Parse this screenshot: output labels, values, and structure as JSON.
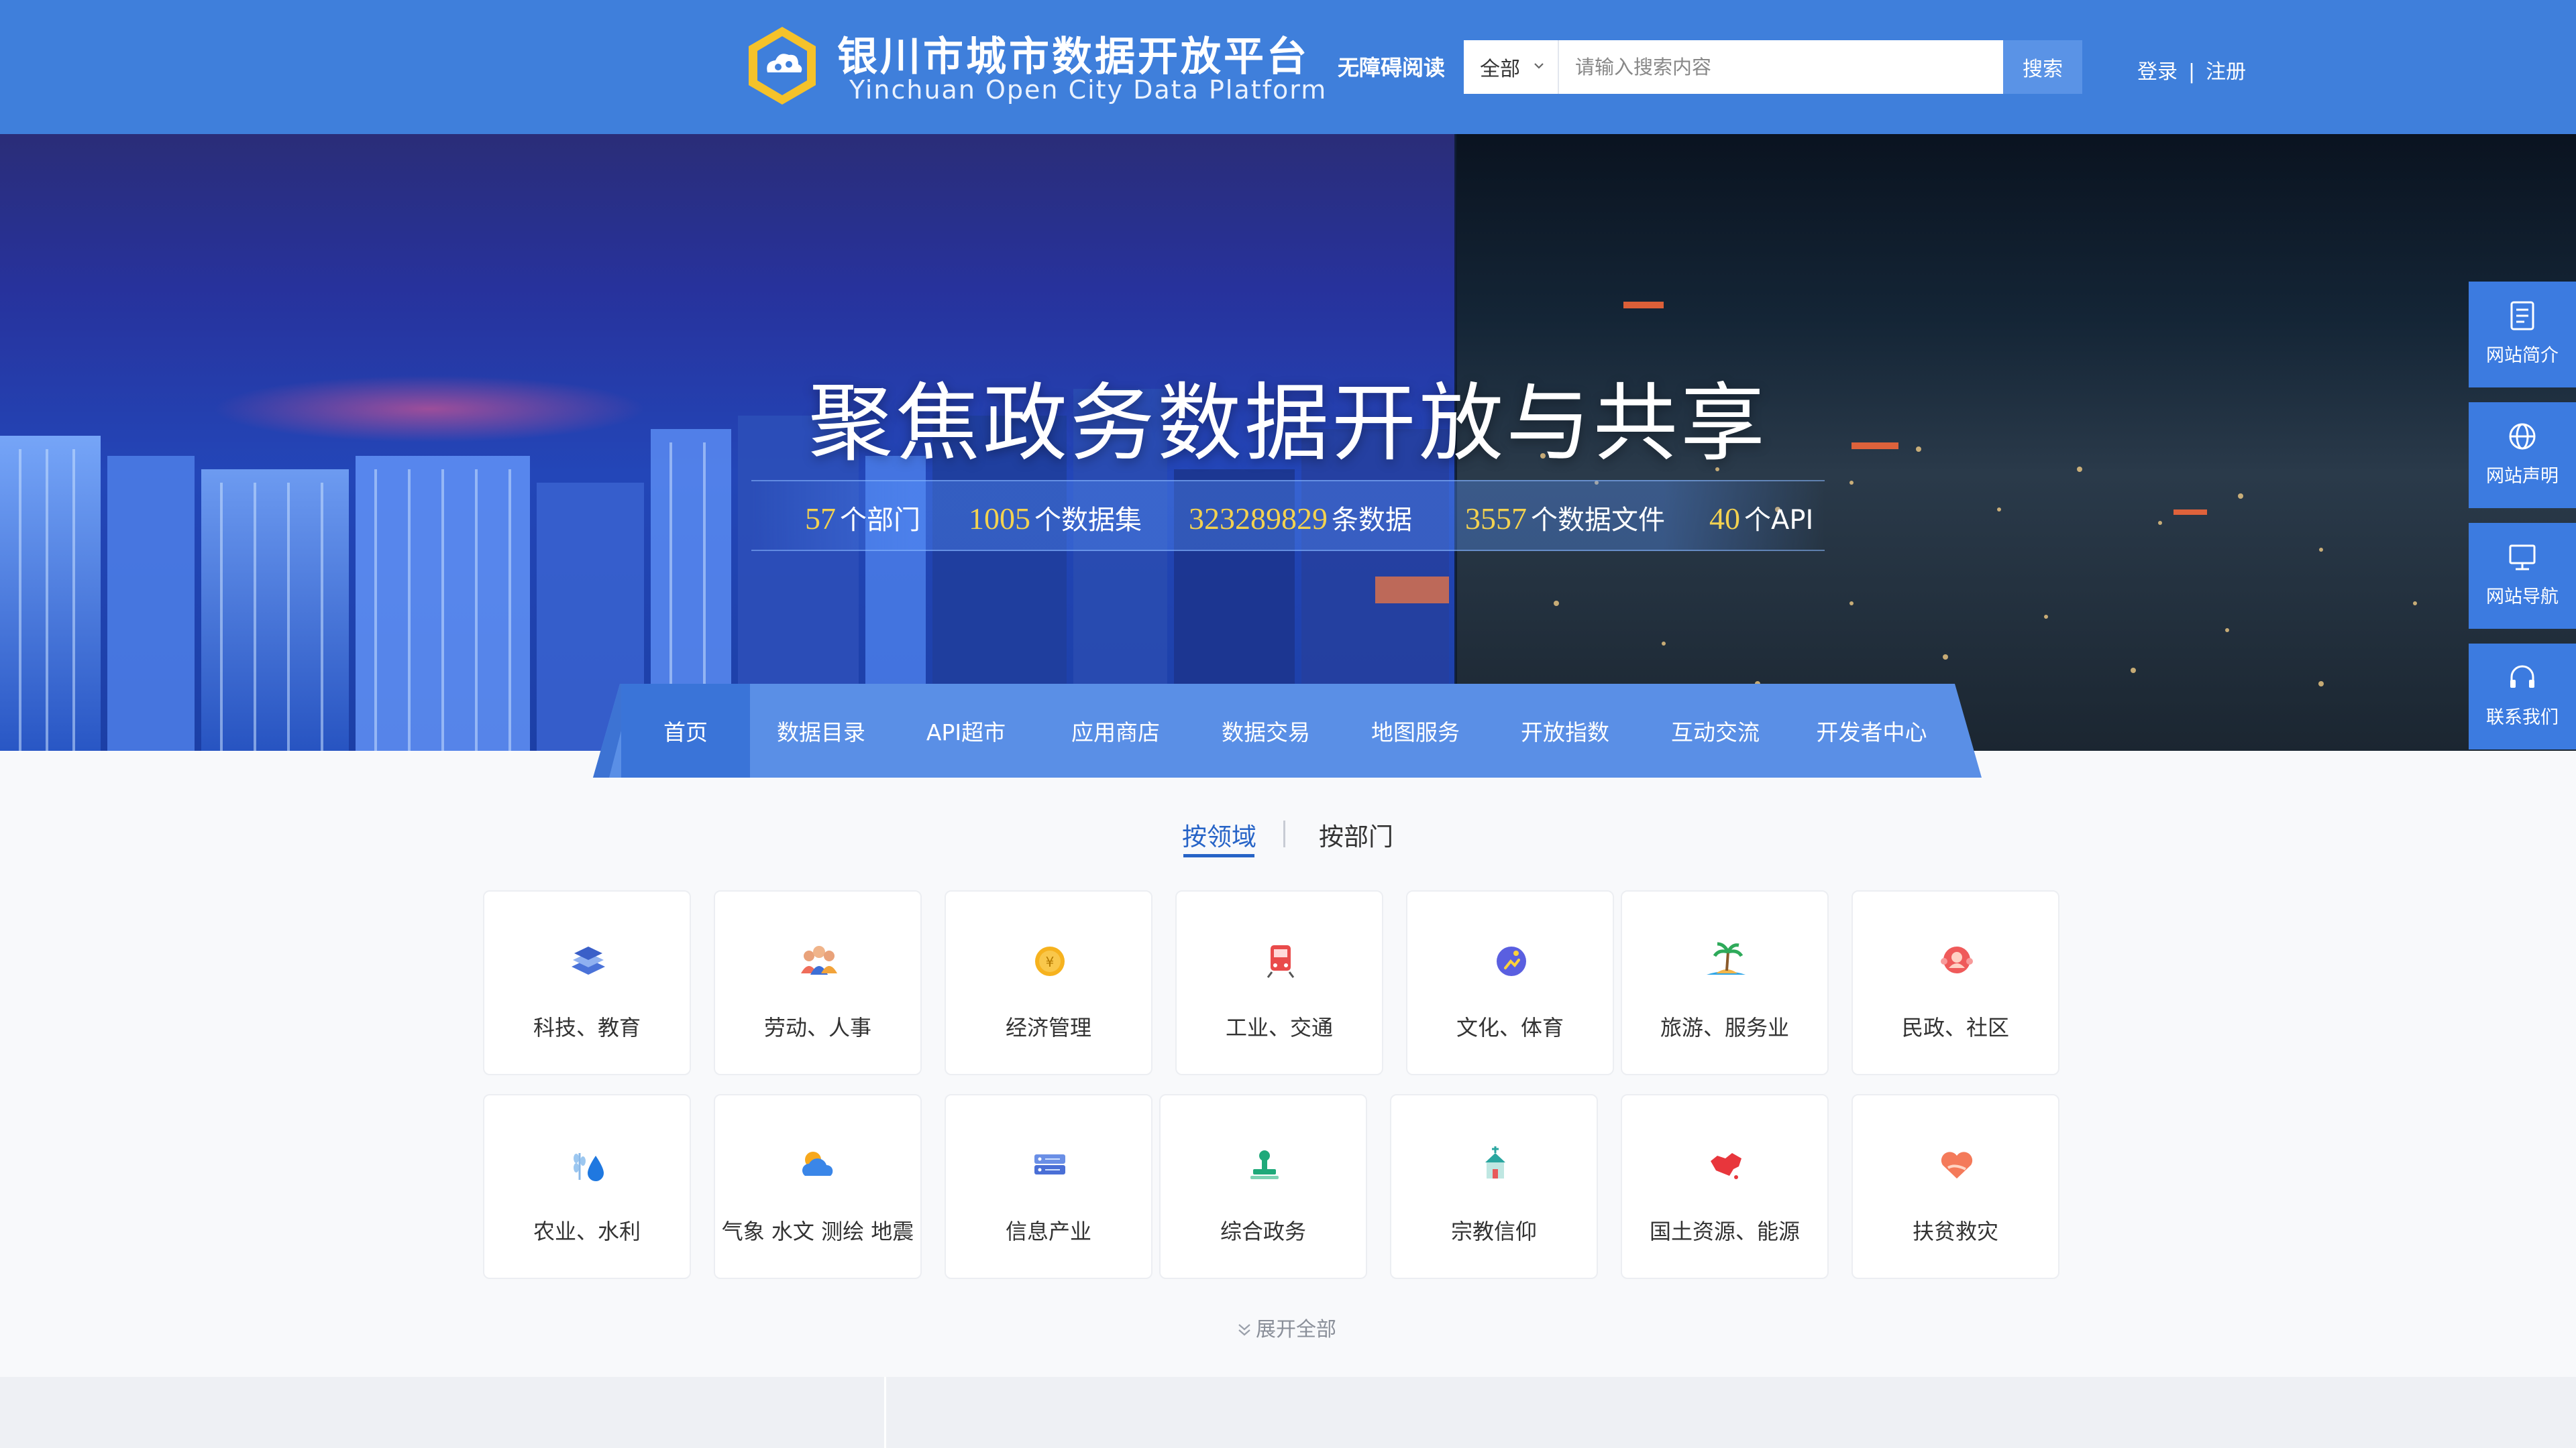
{
  "brand": {
    "title_cn": "银川市城市数据开放平台",
    "title_en": "Yinchuan  Open  City Data  Platform"
  },
  "header": {
    "accessibility_label": "无障碍阅读",
    "search": {
      "scope": "全部",
      "placeholder": "请输入搜索内容",
      "button": "搜索"
    },
    "login": "登录",
    "auth_sep": "|",
    "register": "注册"
  },
  "hero": {
    "title": "聚焦政务数据开放与共享",
    "stats": [
      {
        "value": "57",
        "unit": "个部门"
      },
      {
        "value": "1005",
        "unit": "个数据集"
      },
      {
        "value": "323289829",
        "unit": "条数据"
      },
      {
        "value": "3557",
        "unit": "个数据文件"
      },
      {
        "value": "40",
        "unit": "个API"
      }
    ]
  },
  "nav": {
    "items": [
      "首页",
      "数据目录",
      "API超市",
      "应用商店",
      "数据交易",
      "地图服务",
      "开放指数",
      "互动交流",
      "开发者中心"
    ],
    "active_index": 0
  },
  "side_float": [
    {
      "label": "网站简介",
      "icon": "document-icon"
    },
    {
      "label": "网站声明",
      "icon": "globe-icon"
    },
    {
      "label": "网站导航",
      "icon": "monitor-icon"
    },
    {
      "label": "联系我们",
      "icon": "headset-icon"
    }
  ],
  "category_tabs": {
    "items": [
      "按领域",
      "按部门"
    ],
    "active_index": 0
  },
  "categories": [
    {
      "label": "科技、教育",
      "icon": "books-icon"
    },
    {
      "label": "劳动、人事",
      "icon": "people-icon"
    },
    {
      "label": "经济管理",
      "icon": "coin-icon"
    },
    {
      "label": "工业、交通",
      "icon": "train-icon"
    },
    {
      "label": "文化、体育",
      "icon": "runner-icon"
    },
    {
      "label": "旅游、服务业",
      "icon": "island-icon"
    },
    {
      "label": "民政、社区",
      "icon": "community-icon"
    },
    {
      "label": "农业、水利",
      "icon": "wheat-water-icon"
    },
    {
      "label": "气象 水文 测绘 地震",
      "icon": "weather-icon"
    },
    {
      "label": "信息产业",
      "icon": "server-icon"
    },
    {
      "label": "综合政务",
      "icon": "stamp-icon"
    },
    {
      "label": "宗教信仰",
      "icon": "temple-icon"
    },
    {
      "label": "国土资源、能源",
      "icon": "map-icon"
    },
    {
      "label": "扶贫救灾",
      "icon": "heart-hands-icon"
    }
  ],
  "expand_label": "展开全部",
  "colors": {
    "header_blue": "#3f7fdb",
    "nav_blue": "#5a8fe6",
    "accent_blue": "#2764c7",
    "stat_yellow": "#f3d250"
  }
}
